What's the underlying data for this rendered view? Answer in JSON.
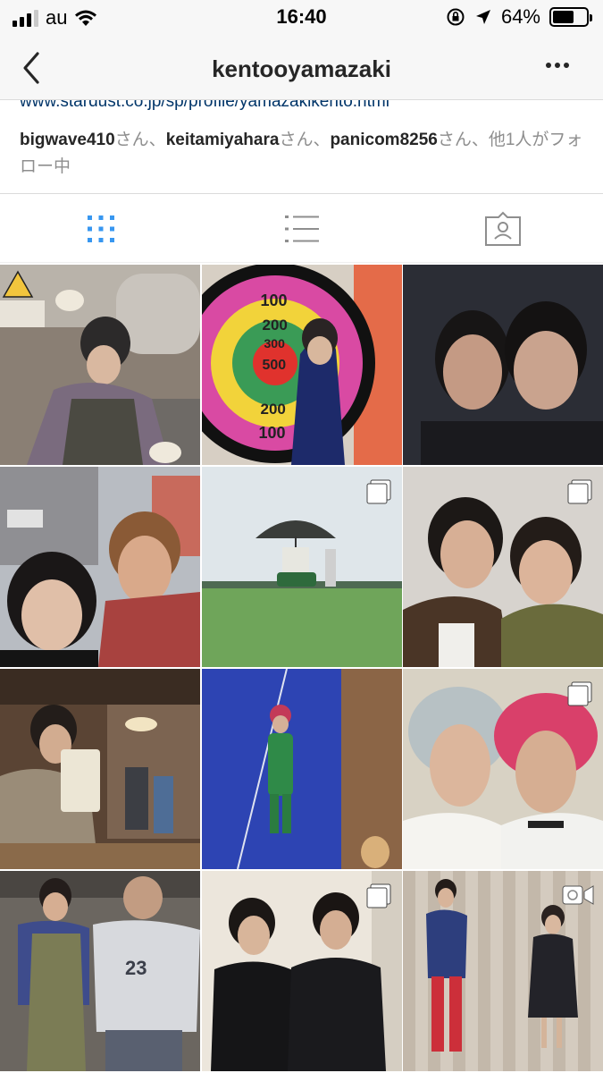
{
  "status_bar": {
    "carrier": "au",
    "time": "16:40",
    "battery": "64%",
    "battery_level": 0.64
  },
  "nav": {
    "title": "kentooyamazaki"
  },
  "profile": {
    "website": "www.stardust.co.jp/sp/profile/yamazakikento.html",
    "followed_by": {
      "users": [
        "bigwave410",
        "keitamiyahara",
        "panicom8256"
      ],
      "suffix": "さん、",
      "tail": "さん、他1人がフォロー中"
    }
  },
  "tabs": [
    {
      "name": "grid",
      "icon": "grid-icon",
      "active": true
    },
    {
      "name": "list",
      "icon": "list-icon",
      "active": false
    },
    {
      "name": "tagged",
      "icon": "tagged-icon",
      "active": false
    }
  ],
  "colors": {
    "active_tab": "#3897f0",
    "inactive_tab": "#8e8e8e",
    "link": "#003569"
  },
  "grid": {
    "posts": [
      {
        "badge": "none"
      },
      {
        "badge": "none",
        "dartboard_labels": [
          "100",
          "200",
          "300",
          "500",
          "200",
          "100"
        ]
      },
      {
        "badge": "multiple"
      },
      {
        "badge": "none"
      },
      {
        "badge": "multiple"
      },
      {
        "badge": "multiple"
      },
      {
        "badge": "none"
      },
      {
        "badge": "none"
      },
      {
        "badge": "multiple"
      },
      {
        "badge": "none",
        "shirt_text": "23"
      },
      {
        "badge": "multiple"
      },
      {
        "badge": "video"
      }
    ]
  }
}
